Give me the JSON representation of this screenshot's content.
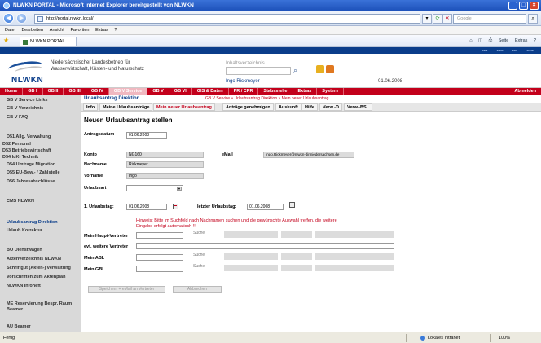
{
  "window": {
    "title": "NLWKN PORTAL - Microsoft Internet Explorer bereitgestellt von NLWKN"
  },
  "browser": {
    "address": "http://portal.nlwkn.local/",
    "search_placeholder": "Google",
    "menu": [
      "Datei",
      "Bearbeiten",
      "Ansicht",
      "Favoriten",
      "Extras",
      "?"
    ],
    "tab_label": "NLWKN PORTAL",
    "commands": [
      "Seite",
      "Extras"
    ]
  },
  "header": {
    "logo_text": "NLWKN",
    "org_line1": "Niedersächsischer Landesbetrieb für",
    "org_line2": "Wasserwirtschaft, Küsten- und Naturschutz",
    "search_label": "Inhaltsverzeichnis",
    "user": "Ingo Rickmeyer",
    "date": "01.06.2008"
  },
  "mainnav": {
    "items": [
      "Home",
      "GB I",
      "GB II",
      "GB III",
      "GB IV",
      "GB V Service",
      "GB V",
      "GB VI",
      "GIS & Daten",
      "PR / CPR",
      "Stabsstelle",
      "Extras",
      "System"
    ],
    "logout": "Abmelden"
  },
  "sidebar": {
    "items": [
      "GB V Service Links",
      "GB V Verzeichnis",
      "GB V FAQ",
      "D51 Allg. Verwaltung",
      "D52 Personal",
      "D53 Betriebswirtschaft",
      "D54 IuK- Technik",
      "D54 Umfrage Migration",
      "D55 EU-Bew.- / Zahlstelle",
      "D56 Jahresabschlüsse",
      "CMS NLWKN",
      "Urlaubsantrag Direktion",
      "Urlaub Korrektur",
      "BO Dienstwagen",
      "Aktenverzeichnis NLWKN",
      "Schriftgut (Akten-) verwaltung",
      "Vorschriften zum Aktenplan",
      "NLWKN Infoheft",
      "ME Reservierung Bespr. Raum Beamer",
      "AU Beamer"
    ]
  },
  "content": {
    "section_title": "Urlaubsantrag Direktion",
    "breadcrumb": "GB V Service  »  Urlaubsantrag Direktion  »  Mein neuer Urlaubsantrag",
    "tabs": [
      "Info",
      "Meine Urlaubsanträge",
      "Mein neuer Urlaubsantrag",
      "Anträge genehmigen",
      "Auskunft",
      "Hilfe",
      "Verw.-D",
      "Verw.-BSL"
    ],
    "page_title": "Neuen Urlaubsantrag stellen",
    "form": {
      "antragsdatum_label": "Antragsdatum",
      "antragsdatum": "01.06.2008",
      "konto_label": "Konto",
      "konto": "NG160",
      "email_label": "eMail",
      "email": "Ingo.Rickmeyer@nlwkn-dir.niedersachsen.de",
      "nachname_label": "Nachname",
      "nachname": "Rickmeyer",
      "vorname_label": "Vorname",
      "vorname": "Ingo",
      "urlaubsart_label": "Urlaubsart",
      "urlaubstag1_label": "1. Urlaubstag:",
      "urlaubstag1": "01.06.2008",
      "letzter_label": "letzter Urlaubstag:",
      "letzter": "01.06.2008",
      "hint": "Hinweis: Bitte im Suchfeld nach Nachnamen suchen und die gewünschte Auswahl treffen, die weitere Eingabe erfolgt automatisch !!",
      "haupt_label": "Mein Haupt-Vertreter",
      "weitere_label": "evt. weitere Vertreter",
      "abl_label": "Mein ABL",
      "gbl_label": "Mein GBL",
      "suche": "Suche"
    },
    "buttons": {
      "save": "Speichern + eMail an Vertreter",
      "cancel": "Abbrechen"
    }
  },
  "statusbar": {
    "left": "Fertig",
    "zone": "Lokales Intranet",
    "zoom": "100%"
  }
}
